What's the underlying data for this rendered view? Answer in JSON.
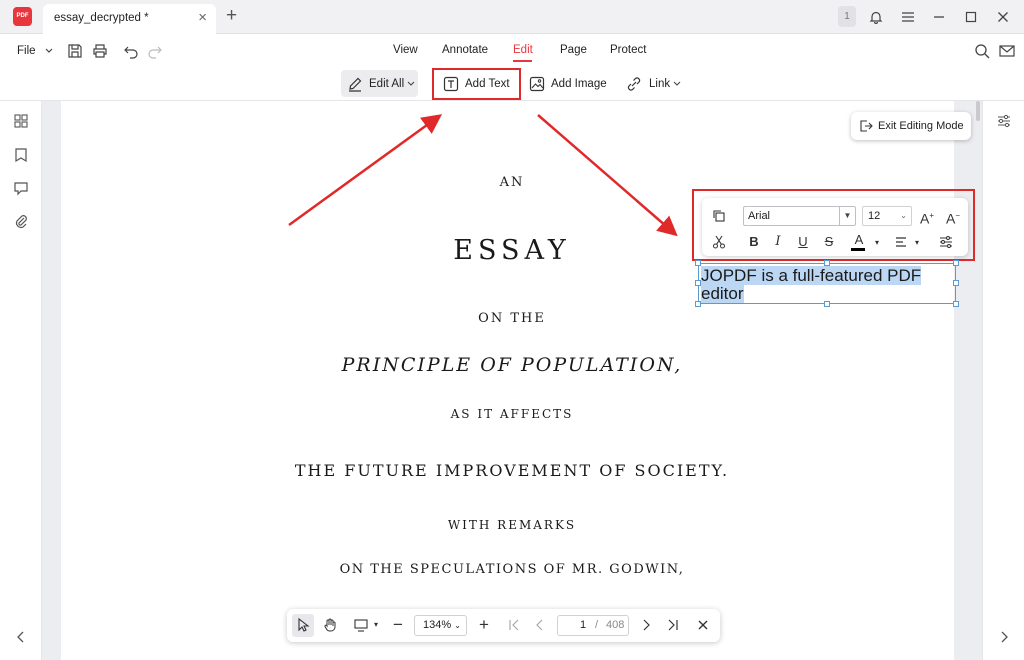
{
  "titlebar": {
    "app_logo_text": "PDF",
    "tab_title": "essay_decrypted *",
    "notification_count": "1"
  },
  "menubar": {
    "file_label": "File",
    "items": [
      "View",
      "Annotate",
      "Edit",
      "Page",
      "Protect"
    ],
    "active_item": "Edit"
  },
  "subtoolbar": {
    "edit_all_label": "Edit All",
    "add_text_label": "Add Text",
    "add_image_label": "Add Image",
    "link_label": "Link"
  },
  "exit_editing_label": "Exit Editing Mode",
  "format_toolbar": {
    "font_name": "Arial",
    "font_size": "12",
    "text_color": "#000000"
  },
  "textbox": {
    "line1": "JOPDF is a full-featured PDF",
    "line2": "editor"
  },
  "document": {
    "line_an": "AN",
    "title": "ESSAY",
    "line_on_the": "ON THE",
    "principle": "PRINCIPLE OF POPULATION,",
    "as_it_affects": "AS IT AFFECTS",
    "future": "THE FUTURE IMPROVEMENT OF SOCIETY.",
    "with_remarks": "WITH REMARKS",
    "speculations": "ON THE SPECULATIONS OF MR. GODWIN,"
  },
  "bottombar": {
    "zoom": "134%",
    "current_page": "1",
    "separator": "/",
    "total_pages": "408"
  },
  "colors": {
    "accent": "#e8363d",
    "annotation_red": "#e02a2a",
    "selection_blue": "#bcd7f4",
    "textbox_border": "#5b9bd5"
  }
}
